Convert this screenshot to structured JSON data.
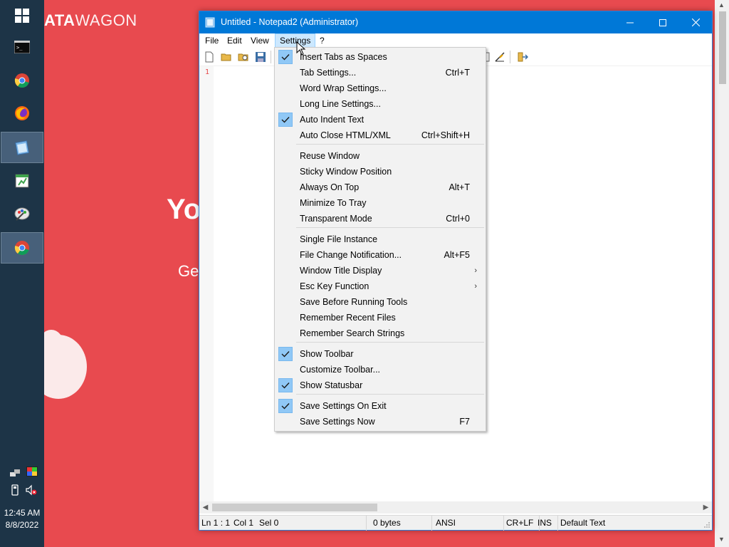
{
  "background": {
    "logo_bold": "ATA",
    "logo_rest": "WAGON",
    "headline_fragment": "Yo",
    "sub_fragment": "Ge"
  },
  "taskbar": {
    "time": "12:45 AM",
    "date": "8/8/2022"
  },
  "window": {
    "title": "Untitled - Notepad2 (Administrator)"
  },
  "menubar": {
    "file": "File",
    "edit": "Edit",
    "view": "View",
    "settings": "Settings",
    "help": "?"
  },
  "editor": {
    "line_number": "1"
  },
  "dropdown": {
    "items": [
      {
        "label": "Insert Tabs as Spaces",
        "shortcut": "",
        "checked": true
      },
      {
        "label": "Tab Settings...",
        "shortcut": "Ctrl+T",
        "checked": false
      },
      {
        "label": "Word Wrap Settings...",
        "shortcut": "",
        "checked": false
      },
      {
        "label": "Long Line Settings...",
        "shortcut": "",
        "checked": false
      },
      {
        "label": "Auto Indent Text",
        "shortcut": "",
        "checked": true
      },
      {
        "label": "Auto Close HTML/XML",
        "shortcut": "Ctrl+Shift+H",
        "checked": false
      },
      {
        "label": "Reuse Window",
        "shortcut": "",
        "checked": false
      },
      {
        "label": "Sticky Window Position",
        "shortcut": "",
        "checked": false
      },
      {
        "label": "Always On Top",
        "shortcut": "Alt+T",
        "checked": false
      },
      {
        "label": "Minimize To Tray",
        "shortcut": "",
        "checked": false
      },
      {
        "label": "Transparent Mode",
        "shortcut": "Ctrl+0",
        "checked": false
      },
      {
        "label": "Single File Instance",
        "shortcut": "",
        "checked": false
      },
      {
        "label": "File Change Notification...",
        "shortcut": "Alt+F5",
        "checked": false
      },
      {
        "label": "Window Title Display",
        "shortcut": "",
        "checked": false,
        "submenu": true
      },
      {
        "label": "Esc Key Function",
        "shortcut": "",
        "checked": false,
        "submenu": true
      },
      {
        "label": "Save Before Running Tools",
        "shortcut": "",
        "checked": false
      },
      {
        "label": "Remember Recent Files",
        "shortcut": "",
        "checked": false
      },
      {
        "label": "Remember Search Strings",
        "shortcut": "",
        "checked": false
      },
      {
        "label": "Show Toolbar",
        "shortcut": "",
        "checked": true
      },
      {
        "label": "Customize Toolbar...",
        "shortcut": "",
        "checked": false
      },
      {
        "label": "Show Statusbar",
        "shortcut": "",
        "checked": true
      },
      {
        "label": "Save Settings On Exit",
        "shortcut": "",
        "checked": true
      },
      {
        "label": "Save Settings Now",
        "shortcut": "F7",
        "checked": false
      }
    ]
  },
  "statusbar": {
    "position": "Ln 1 : 1",
    "col": "Col 1",
    "sel": "Sel 0",
    "size": "0 bytes",
    "encoding": "ANSI",
    "eol": "CR+LF",
    "mode": "INS",
    "scheme": "Default Text"
  },
  "colors": {
    "accent": "#0078d7",
    "background_site": "#e84a4f",
    "taskbar": "#1d3447",
    "check_highlight": "#90c8f6"
  }
}
